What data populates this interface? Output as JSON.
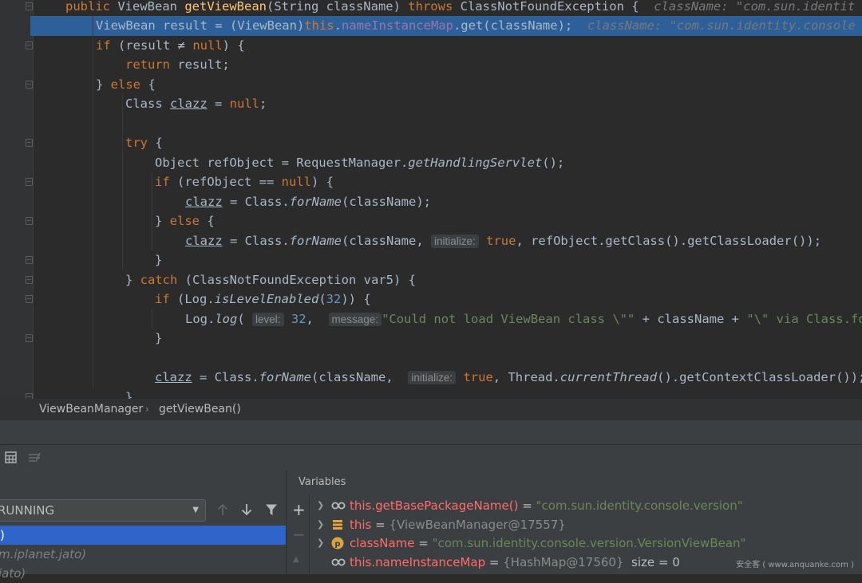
{
  "editor": {
    "lines": [
      {
        "tokens": [
          [
            "kw",
            "public "
          ],
          [
            "",
            "ViewBean "
          ],
          [
            "fn",
            "getViewBean"
          ],
          [
            "",
            "(String className) "
          ],
          [
            "kw",
            "throws "
          ],
          [
            "",
            "ClassNotFoundException {"
          ]
        ],
        "inline": "className: \"com.sun.identit"
      },
      {
        "tokens": [
          [
            "",
            "ViewBean result = (ViewBean)"
          ],
          [
            "kw",
            "this"
          ],
          [
            "",
            "."
          ],
          [
            "fld",
            "nameInstanceMap"
          ],
          [
            "",
            ".get(className);"
          ]
        ],
        "inline": "className: \"com.sun.identity.console"
      },
      {
        "tokens": [
          [
            "kw",
            "if "
          ],
          [
            "",
            "(result ≠ "
          ],
          [
            "kw",
            "null"
          ],
          [
            "",
            ") {"
          ]
        ]
      },
      {
        "tokens": [
          [
            "kw",
            "return "
          ],
          [
            "",
            "result;"
          ]
        ]
      },
      {
        "tokens": [
          [
            "",
            "} "
          ],
          [
            "kw",
            "else "
          ],
          [
            "",
            "{"
          ]
        ]
      },
      {
        "tokens": [
          [
            "",
            "Class "
          ],
          [
            "ul",
            "clazz"
          ],
          [
            "",
            " = "
          ],
          [
            "kw",
            "null"
          ],
          [
            "",
            ";"
          ]
        ]
      },
      {
        "tokens": []
      },
      {
        "tokens": [
          [
            "kw",
            "try "
          ],
          [
            "",
            "{"
          ]
        ]
      },
      {
        "tokens": [
          [
            "",
            "Object refObject = RequestManager."
          ],
          [
            "it",
            "getHandlingServlet"
          ],
          [
            "",
            "();"
          ]
        ]
      },
      {
        "tokens": [
          [
            "kw",
            "if "
          ],
          [
            "",
            "(refObject == "
          ],
          [
            "kw",
            "null"
          ],
          [
            "",
            ") {"
          ]
        ]
      },
      {
        "tokens": [
          [
            "ul",
            "clazz"
          ],
          [
            "",
            " = Class."
          ],
          [
            "it",
            "forName"
          ],
          [
            "",
            "(className);"
          ]
        ]
      },
      {
        "tokens": [
          [
            "",
            "} "
          ],
          [
            "kw",
            "else "
          ],
          [
            "",
            "{"
          ]
        ]
      },
      {
        "tokens": [
          [
            "ul",
            "clazz"
          ],
          [
            "",
            " = Class."
          ],
          [
            "it",
            "forName"
          ],
          [
            "",
            "(className, "
          ],
          [
            "hint",
            "initialize:"
          ],
          [
            "",
            " "
          ],
          [
            "kw",
            "true"
          ],
          [
            "",
            ", refObject.getClass().getClassLoader());"
          ]
        ]
      },
      {
        "tokens": [
          [
            "",
            "}"
          ]
        ]
      },
      {
        "tokens": [
          [
            "",
            "} "
          ],
          [
            "kw",
            "catch "
          ],
          [
            "",
            "(ClassNotFoundException var5) {"
          ]
        ]
      },
      {
        "tokens": [
          [
            "kw",
            "if "
          ],
          [
            "",
            "(Log."
          ],
          [
            "it",
            "isLevelEnabled"
          ],
          [
            "",
            "("
          ],
          [
            "num",
            "32"
          ],
          [
            "",
            ")) {"
          ]
        ]
      },
      {
        "tokens": [
          [
            "",
            "Log."
          ],
          [
            "it",
            "log"
          ],
          [
            "",
            "( "
          ],
          [
            "hint",
            "level:"
          ],
          [
            "",
            " "
          ],
          [
            "num",
            "32"
          ],
          [
            "",
            ",  "
          ],
          [
            "hint",
            "message:"
          ],
          [
            "str",
            "\"Could not load ViewBean class \\\"\""
          ],
          [
            "",
            " + className + "
          ],
          [
            "str",
            "\"\\\" via Class.fo"
          ]
        ]
      },
      {
        "tokens": [
          [
            "",
            "}"
          ]
        ]
      },
      {
        "tokens": []
      },
      {
        "tokens": [
          [
            "ul",
            "clazz"
          ],
          [
            "",
            " = Class."
          ],
          [
            "it",
            "forName"
          ],
          [
            "",
            "(className,  "
          ],
          [
            "hint",
            "initialize:"
          ],
          [
            "",
            " "
          ],
          [
            "kw",
            "true"
          ],
          [
            "",
            ", Thread."
          ],
          [
            "it",
            "currentThread"
          ],
          [
            "",
            "().getContextClassLoader());"
          ]
        ]
      },
      {
        "tokens": [
          [
            "",
            "}"
          ]
        ]
      }
    ]
  },
  "breadcrumb": {
    "class_name": "ViewBeanManager",
    "separator": "›",
    "method_name": "getViewBean()"
  },
  "debugger": {
    "thread_select": "RUNNING",
    "frames": [
      {
        "label": ")"
      },
      {
        "label": "m.iplanet.jato)"
      },
      {
        "label": "jato)"
      }
    ],
    "variables_title": "Variables",
    "variables": [
      {
        "icon": "watch-icon",
        "name": "this.getBasePackageName()",
        "eq": " = ",
        "value": "\"com.sun.identity.console.version\"",
        "kind": "str",
        "extra": ""
      },
      {
        "icon": "object-icon",
        "name": "this",
        "eq": " = ",
        "value": "{ViewBeanManager@17557}",
        "kind": "ref",
        "extra": ""
      },
      {
        "icon": "param-icon",
        "name": "className",
        "eq": " = ",
        "value": "\"com.sun.identity.console.version.VersionViewBean\"",
        "kind": "str",
        "extra": ""
      },
      {
        "icon": "watch-icon",
        "name": "this.nameInstanceMap",
        "eq": " = ",
        "value": "{HashMap@17560}",
        "kind": "ref",
        "extra": "  size = 0"
      }
    ]
  },
  "watermark": "安全客 ( www.anquanke.com )",
  "colors": {
    "editor_bg": "#2b2b2b",
    "current_line": "#2d6099",
    "keyword": "#cc7832",
    "method": "#ffc66d",
    "field": "#9876aa",
    "string": "#6a8759",
    "number": "#6897bb",
    "selected_frame": "#2f65ca"
  }
}
